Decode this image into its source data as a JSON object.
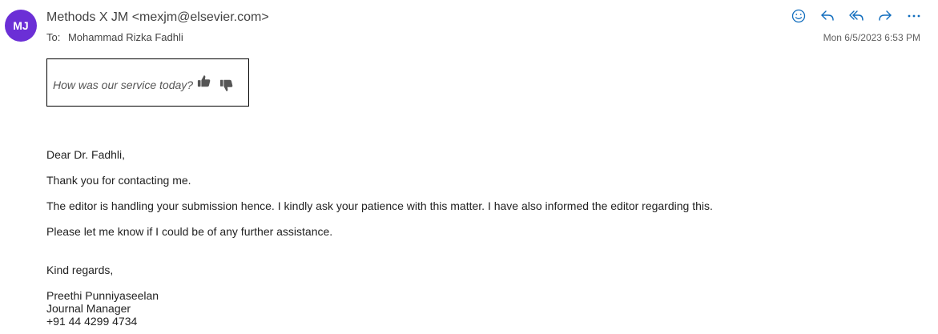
{
  "header": {
    "avatar_initials": "MJ",
    "avatar_color": "#6b2fd6",
    "sender": "Methods X JM <mexjm@elsevier.com>",
    "to_prefix": "To:",
    "to_name": "Mohammad Rizka Fadhli",
    "timestamp": "Mon 6/5/2023 6:53 PM",
    "accent_color": "#0f6cbd",
    "actions": [
      {
        "icon": "emoji-icon"
      },
      {
        "icon": "reply-icon"
      },
      {
        "icon": "reply-all-icon"
      },
      {
        "icon": "forward-icon"
      },
      {
        "icon": "more-icon"
      }
    ]
  },
  "feedback": {
    "question": "How was our service today?",
    "thumbs_up_icon": "thumbs-up-icon",
    "thumbs_down_icon": "thumbs-down-icon"
  },
  "body": {
    "greeting": "Dear Dr. Fadhli,",
    "line1": "Thank you for contacting me.",
    "line2": "The editor is handling your submission hence. I kindly ask your patience with this matter. I have also informed the editor regarding this.",
    "line3": "Please let me know if I could be of any further assistance.",
    "closing": "Kind regards,"
  },
  "signature": {
    "name": "Preethi Punniyaseelan",
    "title": "Journal Manager",
    "phone": "+91 44 4299 4734"
  }
}
